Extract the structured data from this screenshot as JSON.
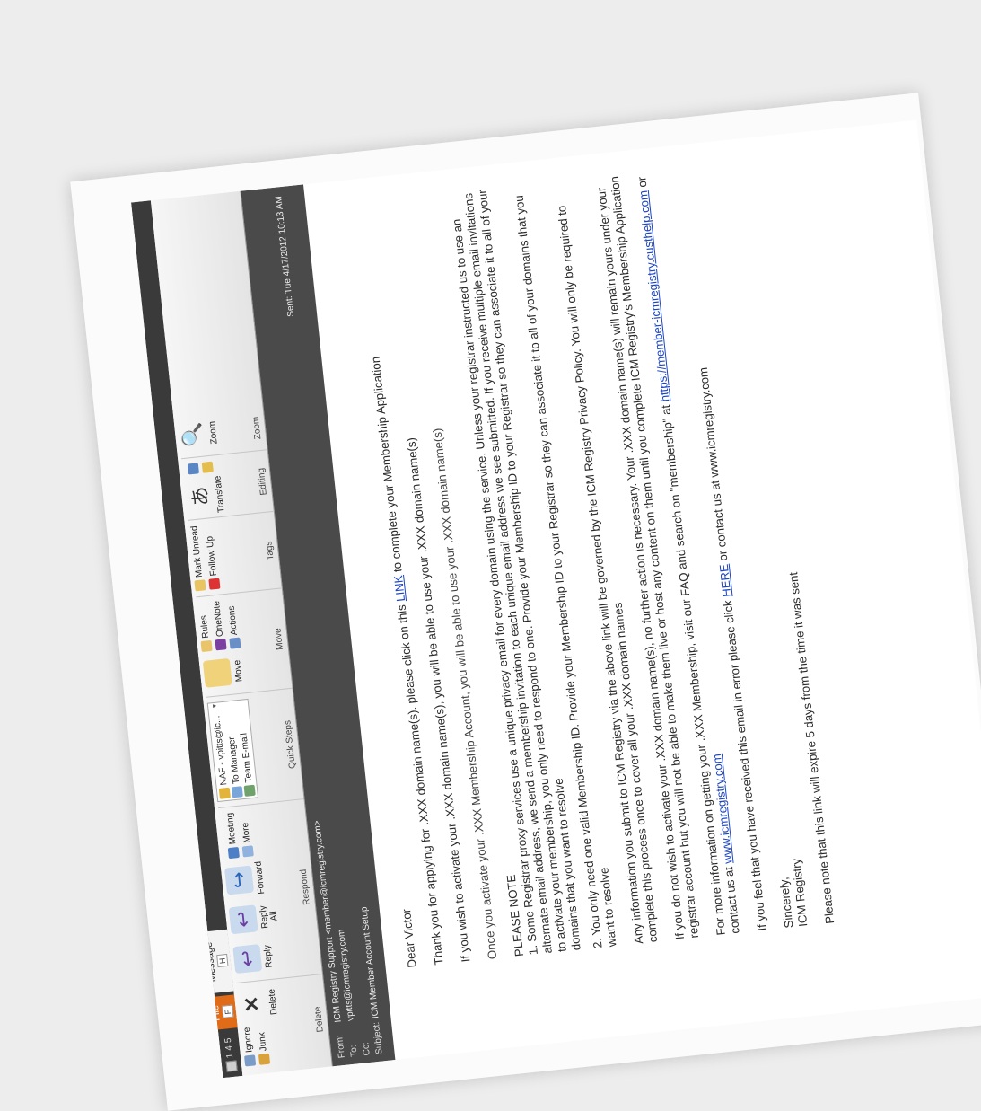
{
  "ribbon": {
    "qat_numbers": [
      "1",
      "4",
      "5"
    ],
    "tabs": {
      "file": "File",
      "file_key": "F",
      "message": "Message",
      "message_key": "H"
    },
    "groups": {
      "delete": {
        "label": "Delete",
        "ignore": "Ignore",
        "junk": "Junk",
        "delete": "Delete"
      },
      "respond": {
        "label": "Respond",
        "reply": "Reply",
        "reply_all": "Reply All",
        "forward": "Forward",
        "meeting": "Meeting",
        "more": "More"
      },
      "quick_steps": {
        "label": "Quick Steps",
        "items": [
          "NAF - vpitts@ic...",
          "To Manager",
          "Team E-mail"
        ]
      },
      "move": {
        "label": "Move",
        "move": "Move",
        "rules": "Rules",
        "onenote": "OneNote",
        "actions": "Actions"
      },
      "tags": {
        "label": "Tags",
        "mark_unread": "Mark Unread",
        "follow_up": "Follow Up"
      },
      "editing": {
        "label": "Editing",
        "translate": "Translate"
      },
      "zoom": {
        "label": "Zoom",
        "zoom": "Zoom"
      }
    }
  },
  "header": {
    "from_label": "From:",
    "from_value": "ICM Registry Support <member@icmregistry.com>",
    "to_label": "To:",
    "to_value": "vpitts@icmregistry.com",
    "cc_label": "Cc:",
    "cc_value": "",
    "subject_label": "Subject:",
    "subject_value": "ICM Member Account Setup",
    "sent_label": "Sent:",
    "sent_value": "Tue 4/17/2012 10:13 AM"
  },
  "body": {
    "greeting": "Dear Victor",
    "p1_before": "Thank you for applying for .XXX domain name(s). please click on this ",
    "p1_link": "LINK",
    "p1_after": " to complete your Membership Application",
    "p2": "If you wish to activate your .XXX domain name(s), you will be able to use your .XXX domain name(s)",
    "p3": "Once you activate your .XXX Membership Account, you will be able to use your .XXX domain name(s)",
    "note_title": "PLEASE NOTE",
    "note1": "1. Some Registrar proxy services use a unique privacy email for every domain using the service. Unless your registrar instructed us to use an alternate email address, we send a membership invitation to each unique email address we see submitted. If you receive multiple email invitations to activate your membership, you only need to respond to one. Provide your Membership ID to your Registrar so they can associate it to all of your domains that you want to resolve",
    "note2": "2. You only need one valid Membership ID. Provide your Membership ID to your Registrar so they can associate it to all of your domains that you want to resolve",
    "p_privacy": "Any information you submit to ICM Registry via the above link will be governed by the ICM Registry Privacy Policy. You will only be required to complete this process once to cover all your .XXX domain names",
    "p_action": "Any information you submit to ICM Registry via the above link will be governed by the ICM Registry Privacy Policy. You will only be required to complete this process once to cover all your .XXX domain names. Your .XXX domain name(s) will remain yours under your registrar account but you will not be able to make them live or host any content on them until you complete ICM Registry's Membership Application",
    "p_nowish_before": "If you do not wish to activate your .XXX domain name(s), no further action is necessary. Your .XXX domain name(s) will remain yours under your registrar account but you will not be able to make them live or host any content on them until you complete ICM Registry's Membership Application",
    "p_more_before": "For more information on getting your .XXX Membership, visit our FAQ and search on \"membership\" at ",
    "p_more_link1": "https://member-icmregistry.custhelp.com",
    "p_more_mid": " or contact us at ",
    "p_more_link2": "www.icmregistry.com",
    "p_error_before": "If you feel that you have received this email in error please click ",
    "p_error_link": "HERE",
    "p_error_after": " or contact us at www.icmregistry.com",
    "sincerely": "Sincerely,",
    "signature": "ICM Registry",
    "p_expire": "Please note that this link will expire 5 days from the time it was sent"
  }
}
